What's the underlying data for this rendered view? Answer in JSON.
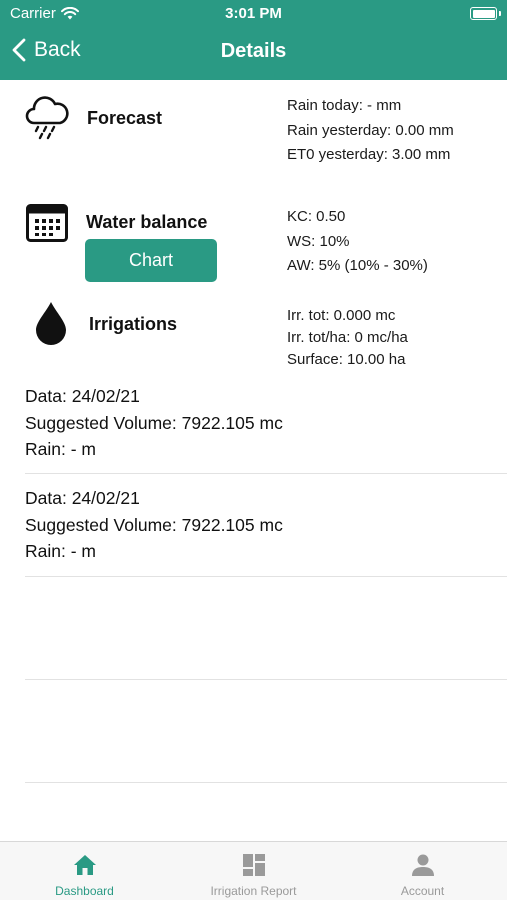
{
  "status_bar": {
    "carrier": "Carrier",
    "time": "3:01 PM"
  },
  "nav": {
    "back_label": "Back",
    "title": "Details"
  },
  "forecast": {
    "title": "Forecast",
    "lines": [
      "Rain today: - mm",
      "Rain yesterday: 0.00 mm",
      "ET0 yesterday: 3.00 mm"
    ]
  },
  "water_balance": {
    "title": "Water balance",
    "chart_button": "Chart",
    "lines": [
      "KC: 0.50",
      "WS: 10%",
      "AW: 5% (10% - 30%)"
    ]
  },
  "irrigations": {
    "title": "Irrigations",
    "lines": [
      "Irr. tot: 0.000 mc",
      "Irr. tot/ha: 0 mc/ha",
      "Surface: 10.00 ha"
    ]
  },
  "records": [
    {
      "date": "Data: 24/02/21",
      "volume": "Suggested Volume: 7922.105 mc",
      "rain": "Rain: - m"
    },
    {
      "date": "Data: 24/02/21",
      "volume": "Suggested Volume: 7922.105 mc",
      "rain": "Rain: - m"
    }
  ],
  "tabs": [
    {
      "label": "Dashboard",
      "icon": "home-icon",
      "active": true
    },
    {
      "label": "Irrigation Report",
      "icon": "grid-icon",
      "active": false
    },
    {
      "label": "Account",
      "icon": "user-icon",
      "active": false
    }
  ],
  "colors": {
    "primary": "#2a9a84",
    "tab_active": "#2a9a84",
    "tab_inactive": "#9a9a9a"
  }
}
